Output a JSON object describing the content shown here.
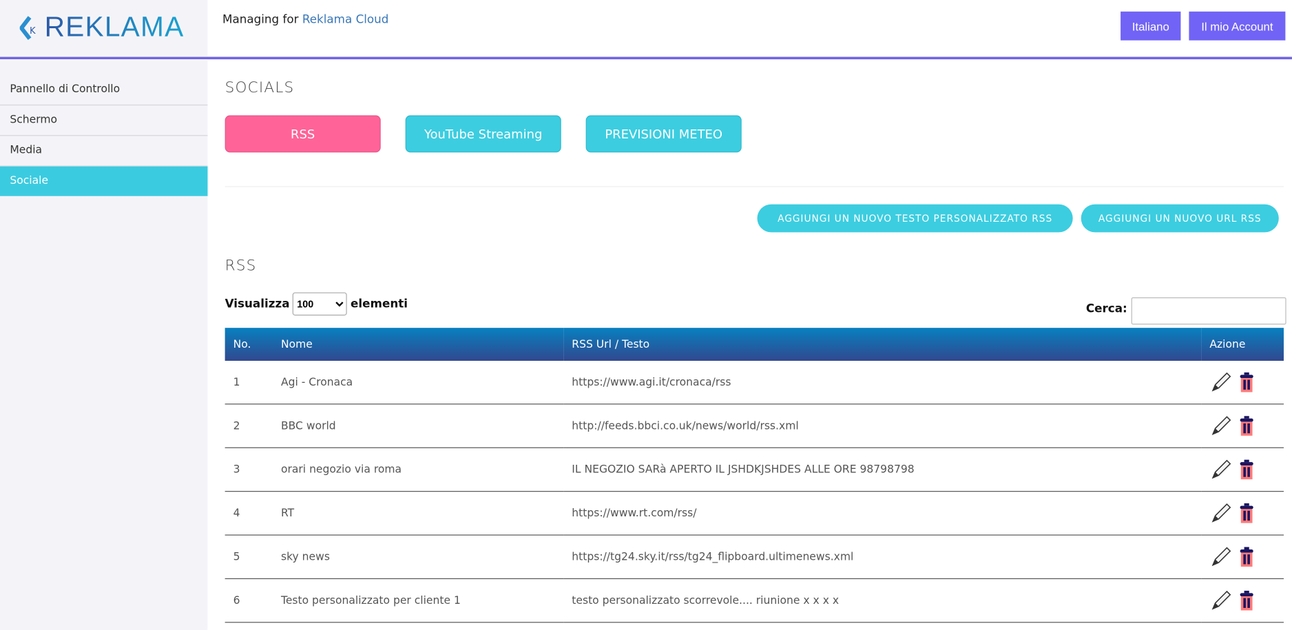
{
  "brand": {
    "logo_text": "REKLAMA",
    "logo_mark": "K"
  },
  "header": {
    "managing_prefix": "Managing for",
    "managing_org": "Reklama Cloud",
    "language_button": "Italiano",
    "account_button": "Il mio Account",
    "accent_color": "#7163f5"
  },
  "sidebar": {
    "items": [
      {
        "label": "Pannello di Controllo"
      },
      {
        "label": "Schermo"
      },
      {
        "label": "Media"
      },
      {
        "label": "Sociale",
        "active": true
      }
    ]
  },
  "main": {
    "title": "SOCIALS",
    "tabs": [
      {
        "label": "RSS",
        "active": true
      },
      {
        "label": "YouTube Streaming"
      },
      {
        "label": "PREVISIONI METEO"
      }
    ],
    "actions": {
      "add_text": "AGGIUNGI UN NUOVO TESTO PERSONALIZZATO RSS",
      "add_url": "AGGIUNGI UN NUOVO URL RSS"
    },
    "section_title": "RSS",
    "length": {
      "prefix": "Visualizza",
      "value": "100",
      "suffix": "elementi"
    },
    "search": {
      "label": "Cerca:",
      "value": ""
    },
    "table": {
      "columns": [
        "No.",
        "Nome",
        "RSS Url / Testo",
        "Azione"
      ],
      "rows": [
        {
          "no": "1",
          "name": "Agi - Cronaca",
          "url": "https://www.agi.it/cronaca/rss"
        },
        {
          "no": "2",
          "name": "BBC world",
          "url": "http://feeds.bbci.co.uk/news/world/rss.xml"
        },
        {
          "no": "3",
          "name": "orari negozio via roma",
          "url": "IL NEGOZIO SARà APERTO IL JSHDKJSHDES ALLE ORE 98798798"
        },
        {
          "no": "4",
          "name": "RT",
          "url": "https://www.rt.com/rss/"
        },
        {
          "no": "5",
          "name": "sky news",
          "url": "https://tg24.sky.it/rss/tg24_flipboard.ultimenews.xml"
        },
        {
          "no": "6",
          "name": "Testo personalizzato per cliente 1",
          "url": "testo personalizzato scorrevole.... riunione x x x x"
        }
      ]
    }
  }
}
